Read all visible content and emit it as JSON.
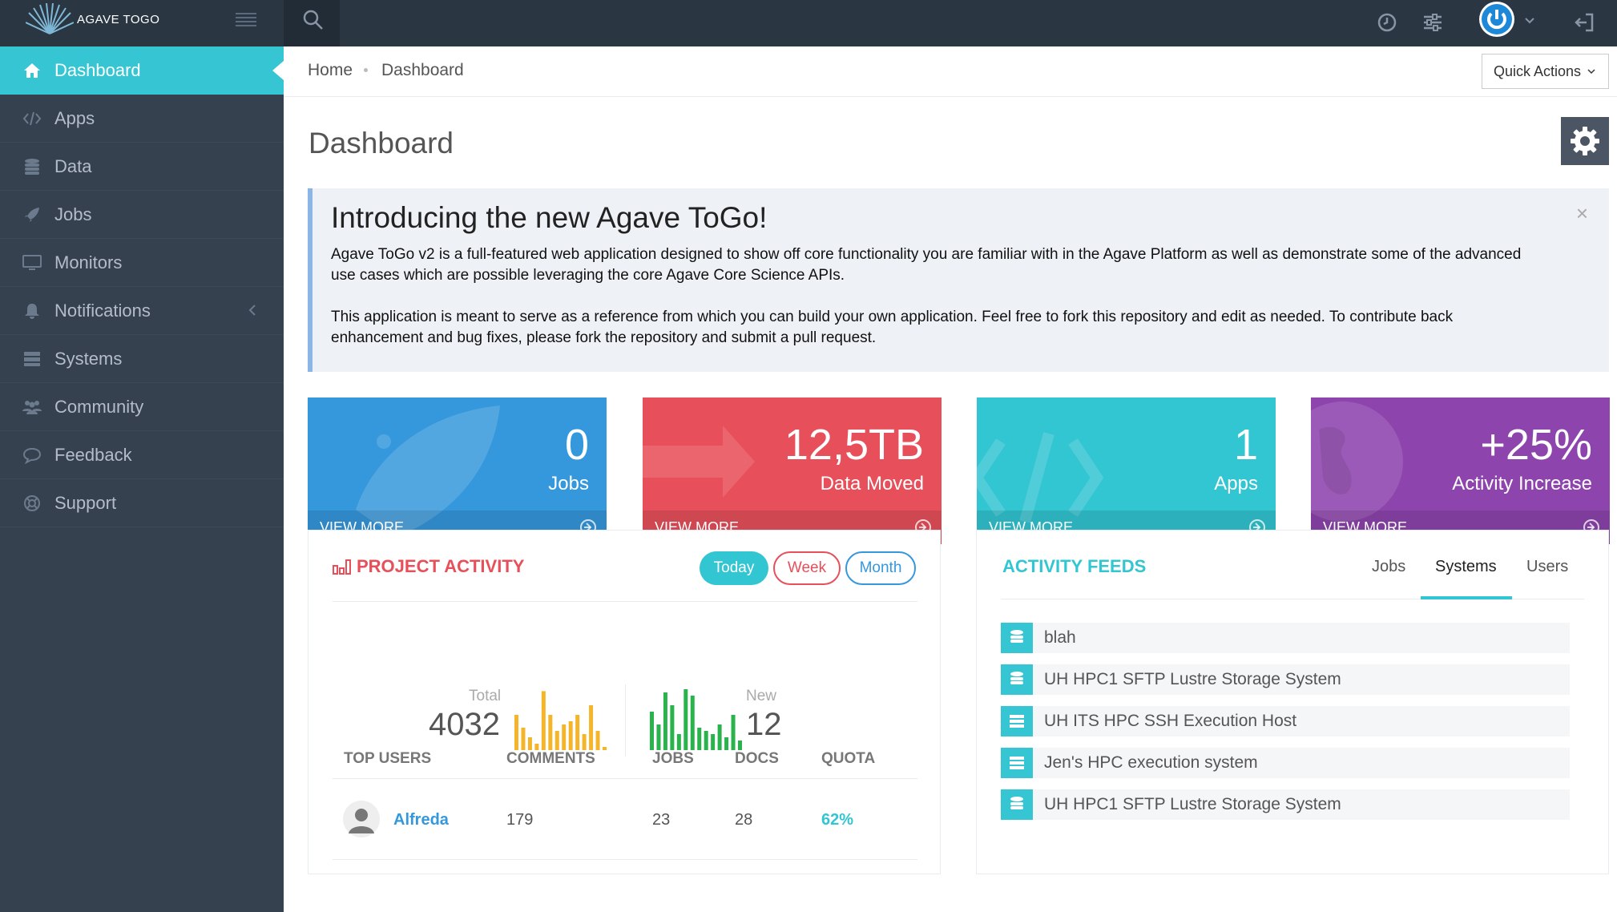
{
  "app": {
    "logo_text": "AGAVE TOGO"
  },
  "colors": {
    "accent": "#36c6d3",
    "sidebar": "#364150",
    "topbar": "#2b3643",
    "red": "#e7505a",
    "blue": "#3598dc",
    "purple": "#8e44ad",
    "orange": "#f4b52b",
    "green": "#2ab34c"
  },
  "sidebar": {
    "items": [
      {
        "label": "Dashboard",
        "icon": "home-icon"
      },
      {
        "label": "Apps",
        "icon": "code-icon"
      },
      {
        "label": "Data",
        "icon": "database-icon"
      },
      {
        "label": "Jobs",
        "icon": "rocket-icon"
      },
      {
        "label": "Monitors",
        "icon": "monitor-icon"
      },
      {
        "label": "Notifications",
        "icon": "bell-icon"
      },
      {
        "label": "Systems",
        "icon": "server-icon"
      },
      {
        "label": "Community",
        "icon": "users-icon"
      },
      {
        "label": "Feedback",
        "icon": "comment-icon"
      },
      {
        "label": "Support",
        "icon": "lifebuoy-icon"
      }
    ]
  },
  "breadcrumb": {
    "home": "Home",
    "current": "Dashboard"
  },
  "quick_actions": "Quick Actions",
  "page_title": "Dashboard",
  "intro": {
    "title": "Introducing the new Agave ToGo!",
    "p1": "Agave ToGo v2 is a full-featured web application designed to show off core functionality you are familiar with in the Agave Platform as well as demonstrate some of the advanced use cases which are possible leveraging the core Agave Core Science APIs.",
    "p2": "This application is meant to serve as a reference from which you can build your own application. Feel free to fork this repository and edit as needed. To contribute back enhancement and bug fixes, please fork the repository and submit a pull request.",
    "close": "×"
  },
  "tiles": [
    {
      "value": "0",
      "label": "Jobs",
      "more": "VIEW MORE",
      "color": "#3598dc"
    },
    {
      "value": "12,5TB",
      "label": "Data Moved",
      "more": "VIEW MORE",
      "color": "#e7505a"
    },
    {
      "value": "1",
      "label": "Apps",
      "more": "VIEW MORE",
      "color": "#32c5d2"
    },
    {
      "value": "+25%",
      "label": "Activity Increase",
      "more": "VIEW MORE",
      "color": "#8e44ad"
    }
  ],
  "project_activity": {
    "title": "PROJECT ACTIVITY",
    "filters": [
      "Today",
      "Week",
      "Month"
    ],
    "total_label": "Total",
    "total_value": "4032",
    "new_label": "New",
    "new_value": "12",
    "total_bars": [
      0.55,
      0.35,
      0.2,
      0.1,
      0.92,
      0.55,
      0.3,
      0.4,
      0.45,
      0.55,
      0.25,
      0.7,
      0.3,
      0.05
    ],
    "new_bars": [
      0.6,
      0.4,
      0.9,
      0.7,
      0.25,
      0.95,
      0.85,
      0.35,
      0.3,
      0.25,
      0.4,
      0.2,
      0.55,
      0.15
    ],
    "columns": [
      "TOP USERS",
      "COMMENTS",
      "JOBS",
      "DOCS",
      "QUOTA"
    ],
    "rows": [
      {
        "user": "Alfreda",
        "comments": "179",
        "jobs": "23",
        "docs": "28",
        "quota": "62%"
      }
    ]
  },
  "activity_feeds": {
    "title": "ACTIVITY FEEDS",
    "tabs": [
      "Jobs",
      "Systems",
      "Users"
    ],
    "active_tab": "Systems",
    "items": [
      {
        "text": "blah",
        "icon": "database-icon"
      },
      {
        "text": "UH HPC1 SFTP Lustre Storage System",
        "icon": "database-icon"
      },
      {
        "text": "UH ITS HPC SSH Execution Host",
        "icon": "server-icon"
      },
      {
        "text": "Jen's HPC execution system",
        "icon": "server-icon"
      },
      {
        "text": "UH HPC1 SFTP Lustre Storage System",
        "icon": "database-icon"
      }
    ]
  }
}
